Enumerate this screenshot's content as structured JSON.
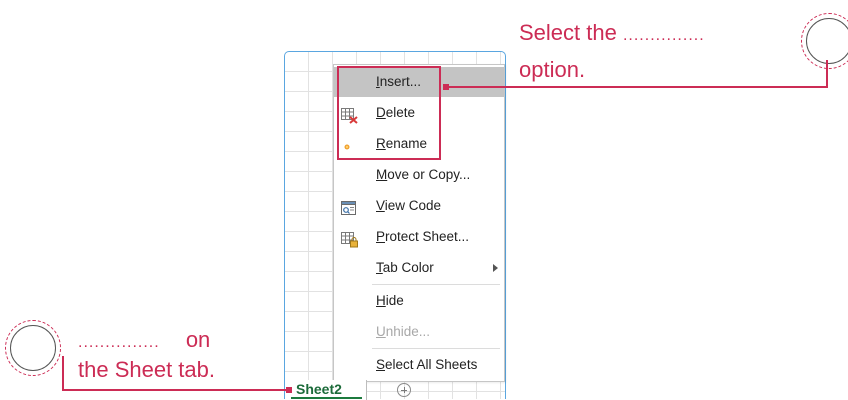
{
  "sheet_tab": {
    "label": "Sheet2"
  },
  "context_menu": {
    "items": [
      {
        "label_before": "",
        "accel": "I",
        "label_after": "nsert...",
        "icon": "",
        "state": "highlighted"
      },
      {
        "label_before": "",
        "accel": "D",
        "label_after": "elete",
        "icon": "delete-sheet-icon",
        "state": "normal"
      },
      {
        "label_before": "",
        "accel": "R",
        "label_after": "ename",
        "icon": "rename-icon",
        "state": "normal"
      },
      {
        "label_before": "",
        "accel": "M",
        "label_after": "ove or Copy...",
        "icon": "",
        "state": "normal"
      },
      {
        "label_before": "",
        "accel": "V",
        "label_after": "iew Code",
        "icon": "view-code-icon",
        "state": "normal"
      },
      {
        "label_before": "",
        "accel": "P",
        "label_after": "rotect Sheet...",
        "icon": "protect-sheet-icon",
        "state": "normal"
      },
      {
        "label_before": "",
        "accel": "T",
        "label_after": "ab Color",
        "icon": "",
        "state": "normal",
        "submenu": true
      },
      {
        "label_before": "",
        "accel": "H",
        "label_after": "ide",
        "icon": "",
        "state": "normal"
      },
      {
        "label_before": "",
        "accel": "U",
        "label_after": "nhide...",
        "icon": "",
        "state": "disabled"
      },
      {
        "label_before": "",
        "accel": "S",
        "label_after": "elect All Sheets",
        "icon": "",
        "state": "normal"
      }
    ]
  },
  "callouts": {
    "top": {
      "line1_text": "Select the",
      "line1_dots": "...............",
      "line2": "option."
    },
    "bottom": {
      "line1_dots": "...............",
      "line1_text": "on",
      "line2": "the Sheet tab."
    }
  },
  "colors": {
    "accent": "#cc2c55",
    "frame_border": "#5aa6e0",
    "tab_green": "#1c6b3a"
  }
}
